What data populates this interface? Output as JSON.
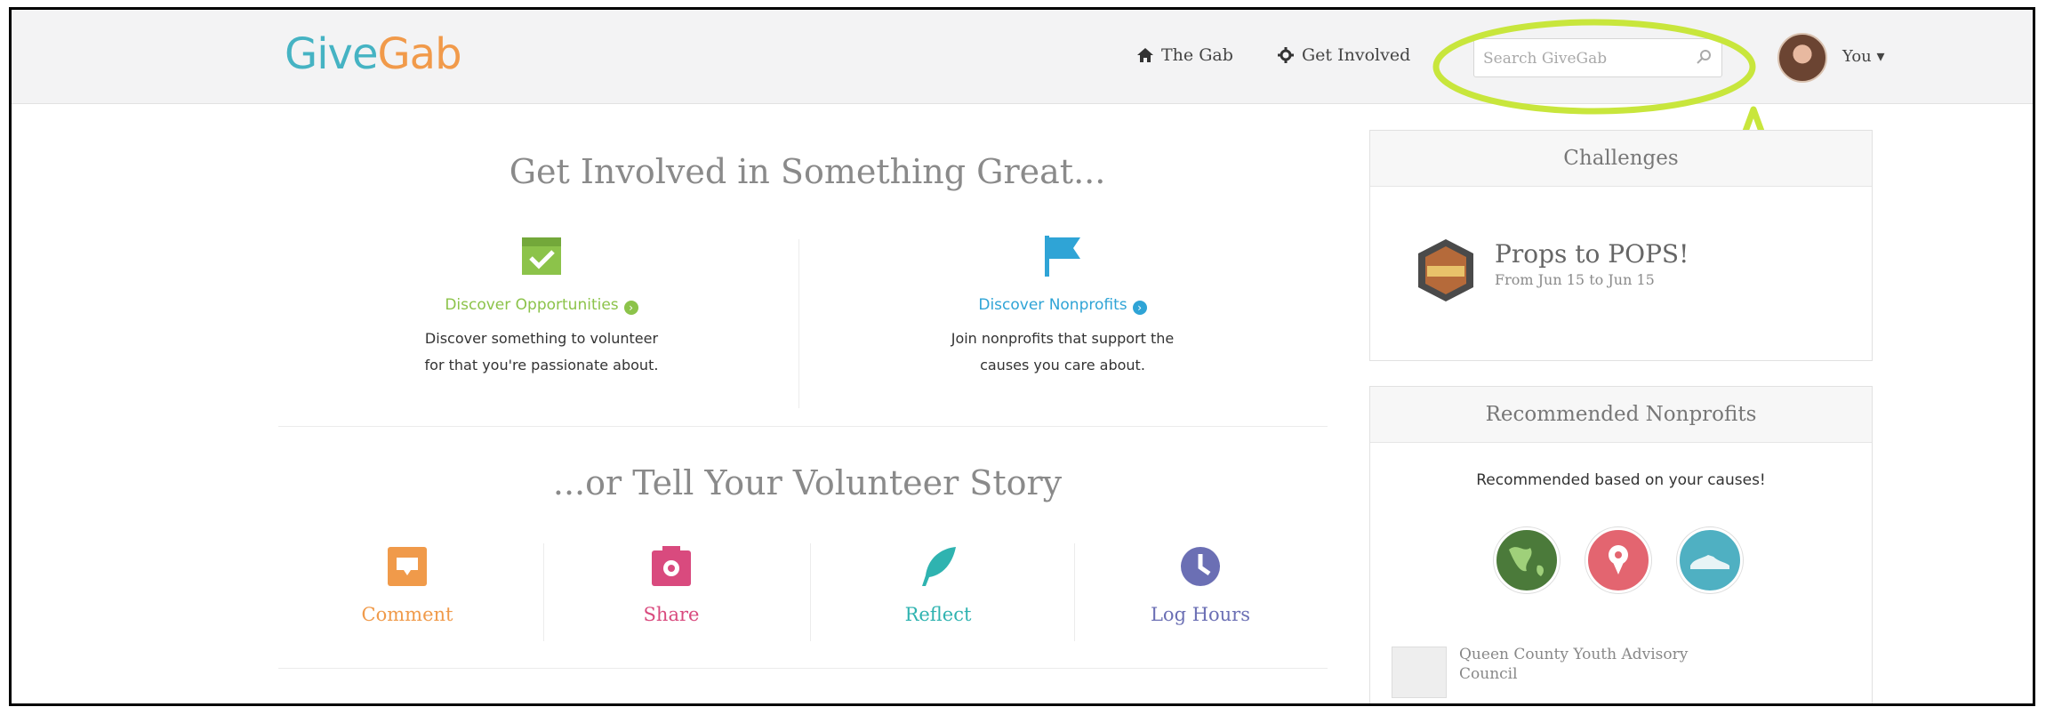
{
  "nav": {
    "logo": {
      "part1": "Give",
      "part2": "Gab"
    },
    "the_gab": "The Gab",
    "get_involved": "Get Involved",
    "search_placeholder": "Search GiveGab",
    "user": "You"
  },
  "main": {
    "title1": "Get Involved in Something Great...",
    "opp": {
      "link": "Discover Opportunities",
      "desc1": "Discover something to volunteer",
      "desc2": "for that you're passionate about."
    },
    "np": {
      "link": "Discover Nonprofits",
      "desc1": "Join nonprofits that support the",
      "desc2": "causes you care about."
    },
    "title2": "...or Tell Your Volunteer Story",
    "actions": [
      {
        "label": "Comment"
      },
      {
        "label": "Share"
      },
      {
        "label": "Reflect"
      },
      {
        "label": "Log Hours"
      }
    ]
  },
  "sidebar": {
    "challenges": {
      "header": "Challenges",
      "item_title": "Props to POPS!",
      "item_dates": "From Jun 15 to Jun 15"
    },
    "recommended": {
      "header": "Recommended Nonprofits",
      "subtitle": "Recommended based on your causes!",
      "org_line1": "Queen County Youth Advisory",
      "org_line2": "Council"
    }
  },
  "colors": {
    "logo_give": "#45b3c3",
    "logo_gab": "#f19a4a",
    "opp_green": "#8cc34a",
    "np_blue": "#2fa4d6",
    "comment_orange": "#f09a4a",
    "share_pink": "#d94a7e",
    "reflect_teal": "#2fb3b0",
    "loghours_purple": "#6b6fb4",
    "highlight": "#c8e63c"
  }
}
